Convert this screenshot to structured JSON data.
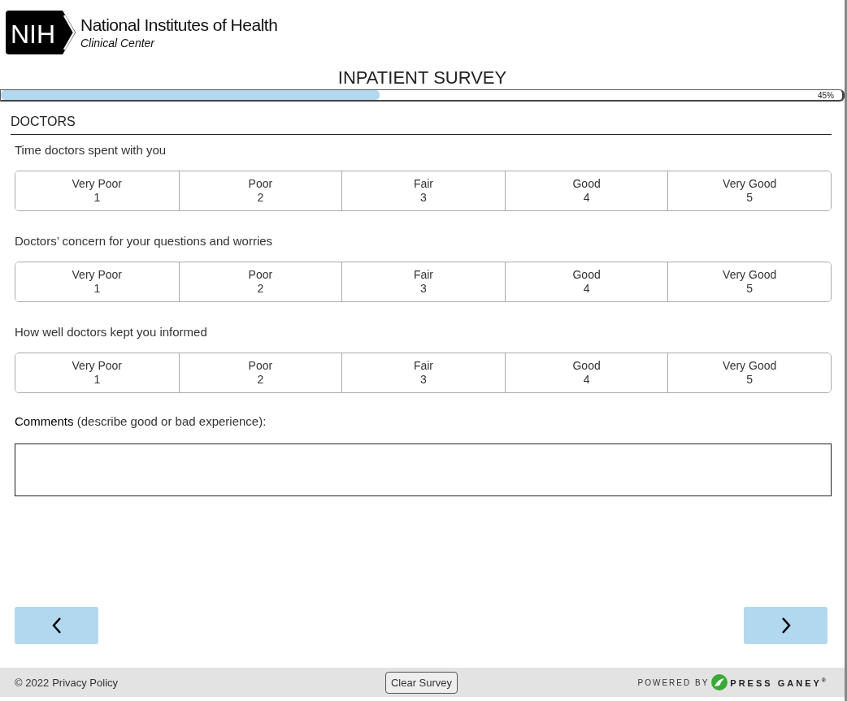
{
  "header": {
    "logo_mark": "NIH",
    "org_name": "National Institutes of Health",
    "org_unit": "Clinical Center"
  },
  "title": "INPATIENT SURVEY",
  "progress": {
    "level": 0.45,
    "reading": "45%"
  },
  "section": "DOCTORS",
  "questions": [
    {
      "text": "Time doctors spent with you",
      "options": [
        {
          "label": "Very Poor",
          "value": "1",
          "selected": false
        },
        {
          "label": "Poor",
          "value": "2",
          "selected": false
        },
        {
          "label": "Fair",
          "value": "3",
          "selected": false
        },
        {
          "label": "Good",
          "value": "4",
          "selected": false
        },
        {
          "label": "Very Good",
          "value": "5",
          "selected": false
        }
      ]
    },
    {
      "text": "Doctors’ concern for your questions and worries",
      "options": [
        {
          "label": "Very Poor",
          "value": "1",
          "selected": false
        },
        {
          "label": "Poor",
          "value": "2",
          "selected": false
        },
        {
          "label": "Fair",
          "value": "3",
          "selected": false
        },
        {
          "label": "Good",
          "value": "4",
          "selected": false
        },
        {
          "label": "Very Good",
          "value": "5",
          "selected": false
        }
      ]
    },
    {
      "text": "How well doctors kept you informed",
      "options": [
        {
          "label": "Very Poor",
          "value": "1",
          "selected": false
        },
        {
          "label": "Poor",
          "value": "2",
          "selected": false
        },
        {
          "label": "Fair",
          "value": "3",
          "selected": false
        },
        {
          "label": "Good",
          "value": "4",
          "selected": false
        },
        {
          "label": "Very Good",
          "value": "5",
          "selected": false
        }
      ]
    }
  ],
  "comments": {
    "label": "**Comments** (describe good or bad experience):"
  },
  "footer": {
    "copyright": "© 2022",
    "privacy_link": "Privacy Policy",
    "clear_button": "Clear Survey",
    "powered_by": "POWERED BY",
    "brand": "PRESS GANEY",
    "brand_mark": "®"
  }
}
